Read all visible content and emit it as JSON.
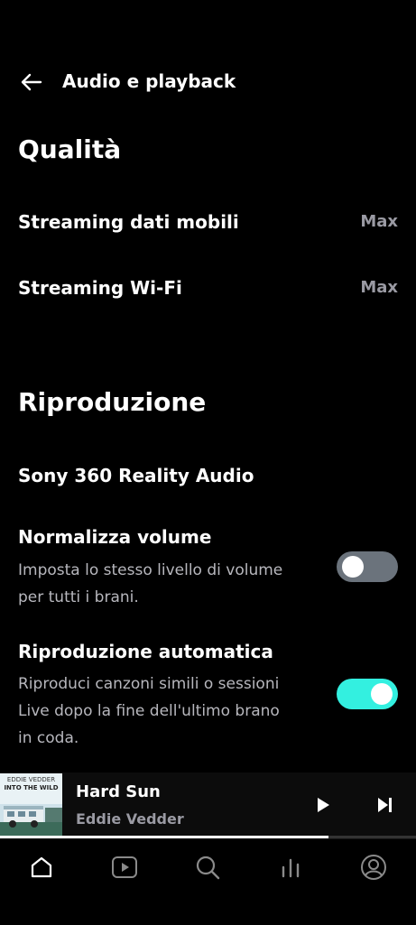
{
  "header": {
    "title": "Audio e playback"
  },
  "quality": {
    "title": "Qualità",
    "mobile": {
      "label": "Streaming dati mobili",
      "value": "Max"
    },
    "wifi": {
      "label": "Streaming Wi-Fi",
      "value": "Max"
    }
  },
  "playback": {
    "title": "Riproduzione",
    "sony": {
      "label": "Sony 360 Reality Audio"
    },
    "normalize": {
      "label": "Normalizza volume",
      "desc": "Imposta lo stesso livello di volume per tutti i brani.",
      "enabled": false
    },
    "autoplay": {
      "label": "Riproduzione automatica",
      "desc": "Riproduci canzoni simili o sessioni Live dopo la fine dell'ultimo brano in coda.",
      "enabled": true
    }
  },
  "player": {
    "title": "Hard Sun",
    "artist": "Eddie Vedder",
    "album_art_text": [
      "EDDIE VEDDER",
      "INTO THE WILD"
    ],
    "progress_fraction": 0.79
  },
  "nav": {
    "icons": [
      "home-icon",
      "video-icon",
      "search-icon",
      "equalizer-icon",
      "profile-icon"
    ],
    "active": "home-icon"
  },
  "colors": {
    "background": "#000000",
    "accent": "#33f0e0",
    "toggle_off": "#6b737c",
    "secondary_text": "#9a9aa3"
  }
}
